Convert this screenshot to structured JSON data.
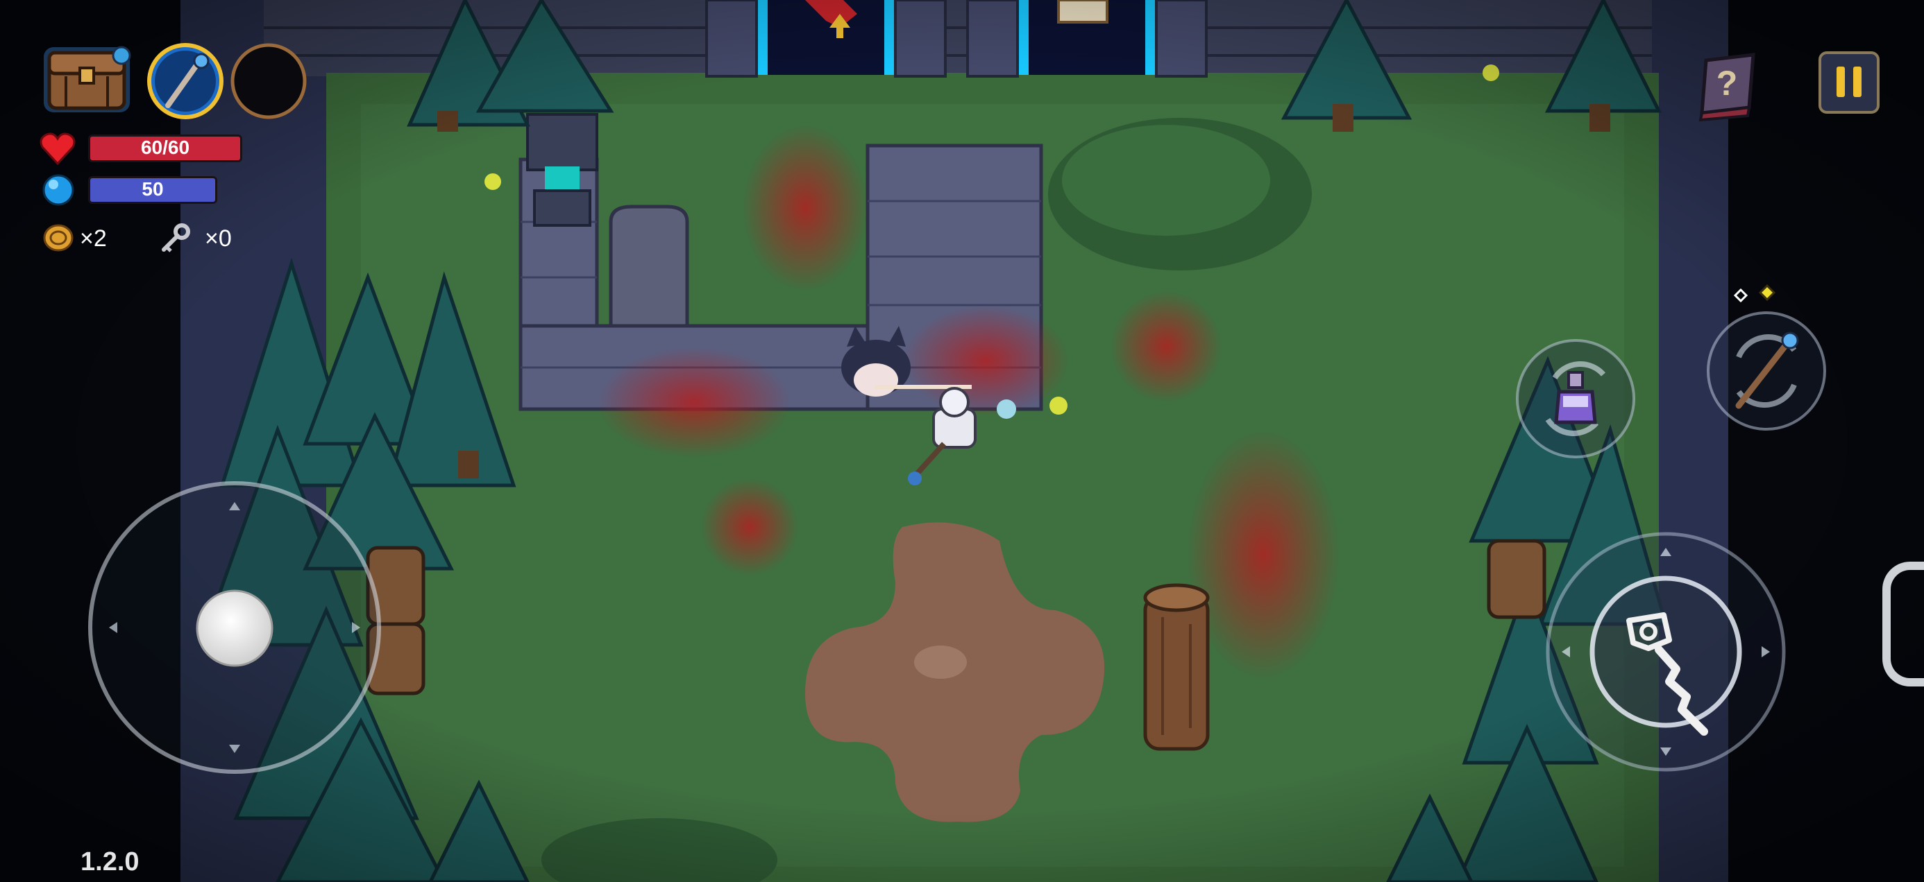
{
  "hud": {
    "health": {
      "current": 60,
      "max": 60,
      "text": "60/60",
      "color": "#c8243a"
    },
    "mana": {
      "current": 50,
      "text": "50",
      "color": "#4a55c8"
    },
    "coins": {
      "text": "×2"
    },
    "keys": {
      "text": "×0"
    },
    "version": "1.2.0"
  },
  "icons": {
    "inventory": "chest-icon",
    "weapon_slot_1": "staff-icon",
    "weapon_slot_2": "empty-slot-icon",
    "help": "help-book-icon",
    "pause": "pause-icon",
    "potion": "potion-icon",
    "swap": "swap-weapon-icon",
    "attack": "attack-staff-icon"
  },
  "colors": {
    "grass": "#3b6a3a",
    "stone": "#555a78",
    "accent_gold": "#f0c030",
    "portal": "#18c8ff"
  }
}
